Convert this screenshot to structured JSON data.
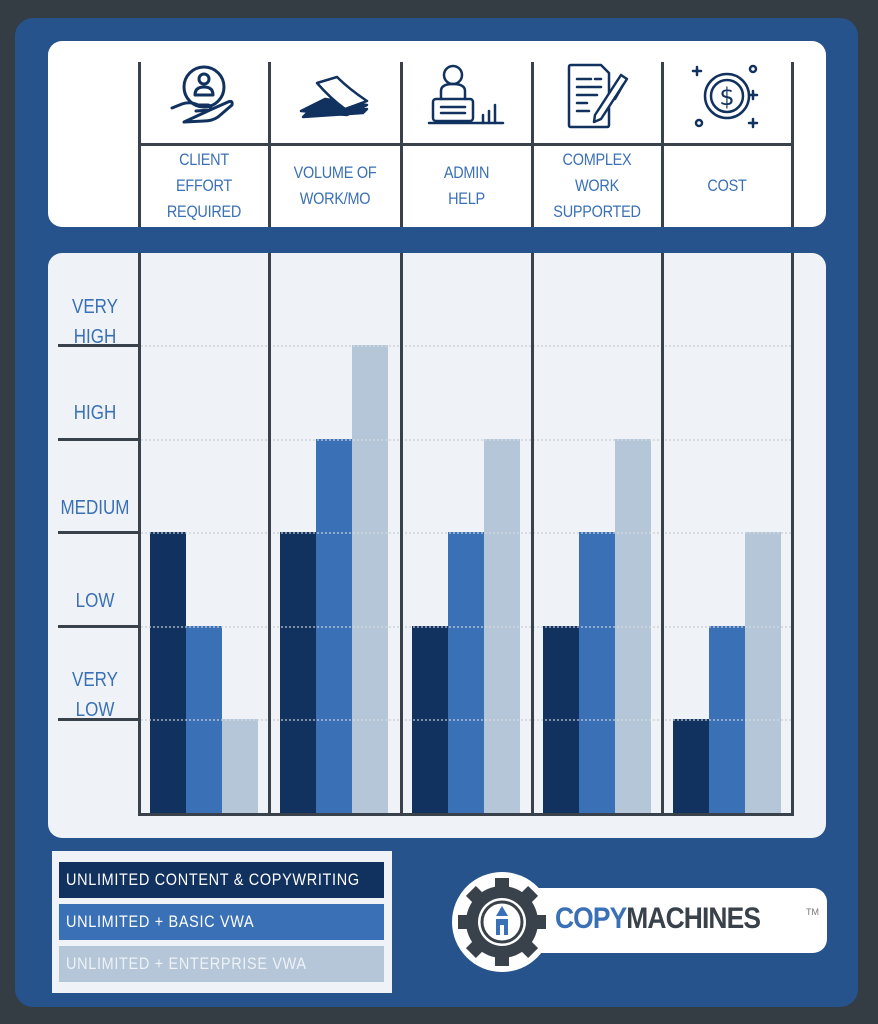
{
  "header": {
    "columns": [
      {
        "label": "CLIENT EFFORT\nREQUIRED",
        "icon": "hand-holding-person-icon"
      },
      {
        "label": "VOLUME OF\nWORK/MO",
        "icon": "paper-stack-icon"
      },
      {
        "label": "ADMIN\nHELP",
        "icon": "person-at-desk-icon"
      },
      {
        "label": "COMPLEX WORK\nSUPPORTED",
        "icon": "document-pen-icon"
      },
      {
        "label": "COST",
        "icon": "dollar-coin-icon"
      }
    ]
  },
  "colors": {
    "background": "#343d44",
    "frame": "#27538c",
    "series_dark": "#11315f",
    "series_mid": "#3a70b6",
    "series_light": "#b4c6d8",
    "axis": "#39424a",
    "label": "#3a70b6"
  },
  "chart_data": {
    "type": "bar",
    "title": "",
    "xlabel": "",
    "ylabel": "",
    "categories": [
      "CLIENT EFFORT REQUIRED",
      "VOLUME OF WORK/MO",
      "ADMIN HELP",
      "COMPLEX WORK SUPPORTED",
      "COST"
    ],
    "y_tick_labels": [
      "VERY\nLOW",
      "LOW",
      "MEDIUM",
      "HIGH",
      "VERY\nHIGH"
    ],
    "y_scale_note": "1=Very Low, 2=Low, 3=Medium, 4=High, 5=Very High",
    "ylim": [
      0,
      6
    ],
    "grid": true,
    "legend_position": "bottom-left",
    "series": [
      {
        "name": "UNLIMITED CONTENT & COPYWRITING",
        "values": [
          3,
          3,
          2,
          2,
          1
        ]
      },
      {
        "name": "UNLIMITED + BASIC VWA",
        "values": [
          2,
          4,
          3,
          3,
          2
        ]
      },
      {
        "name": "UNLIMITED + ENTERPRISE VWA",
        "values": [
          1,
          5,
          4,
          4,
          3
        ]
      }
    ]
  },
  "legend": {
    "items": [
      "UNLIMITED CONTENT & COPYWRITING",
      "UNLIMITED + BASIC VWA",
      "UNLIMITED + ENTERPRISE VWA"
    ]
  },
  "logo": {
    "part1": "COPY",
    "part2": "MACHINES",
    "tm": "TM"
  }
}
